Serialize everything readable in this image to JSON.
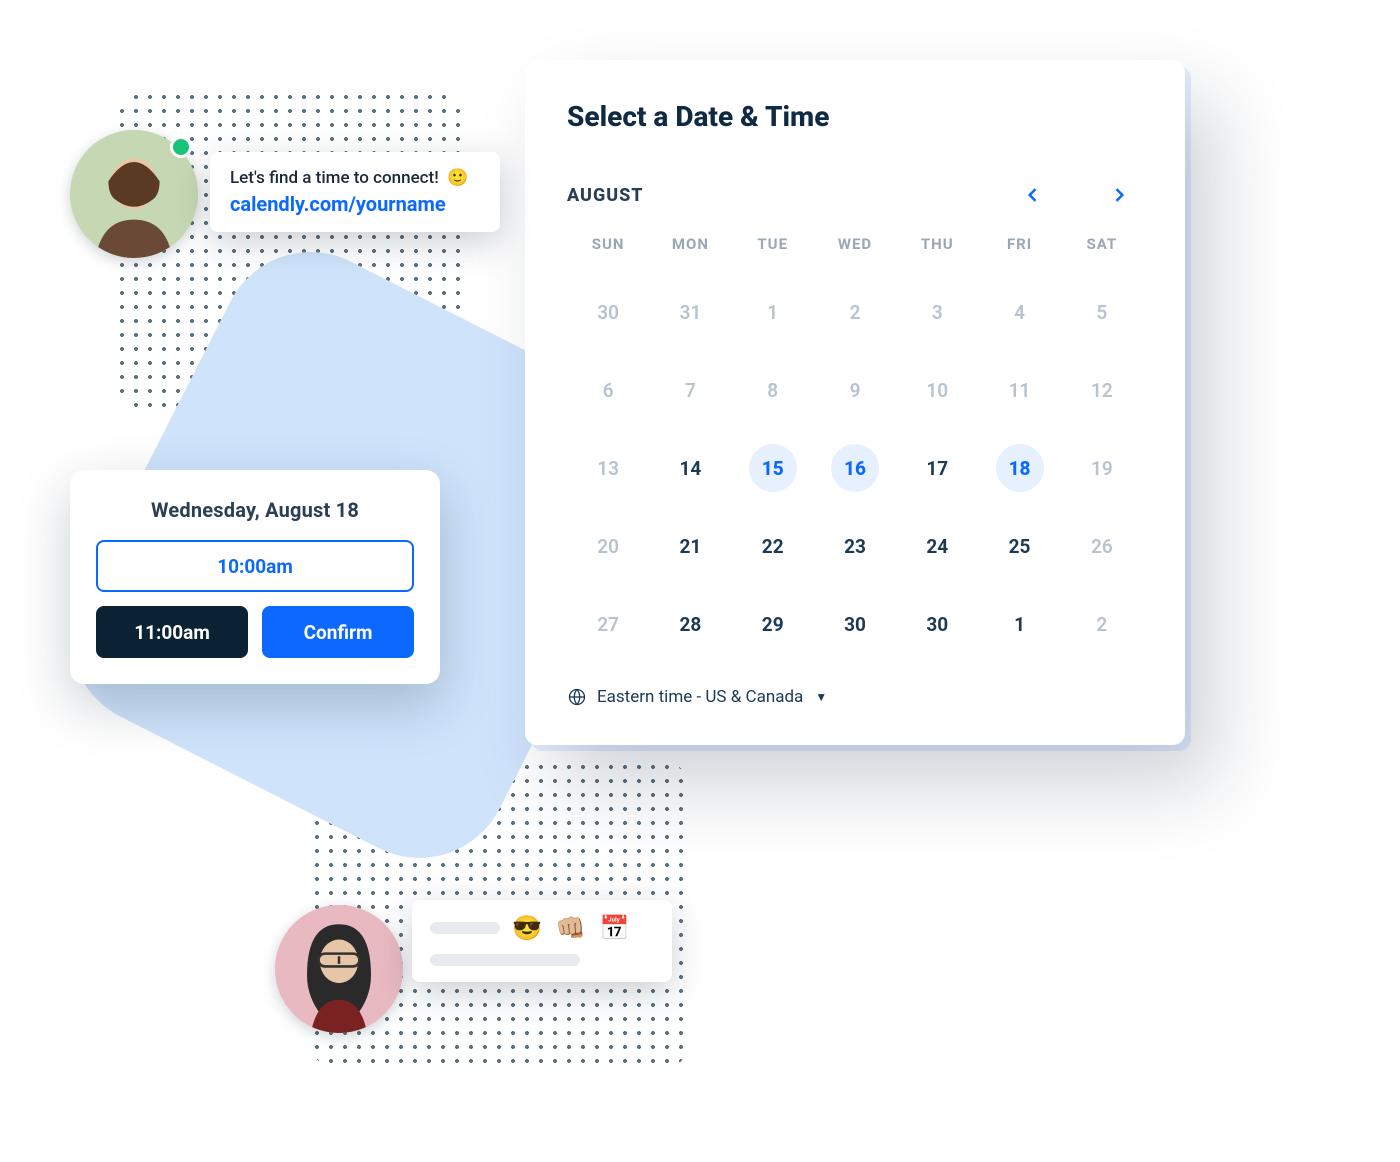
{
  "colors": {
    "primary": "#0b69ff",
    "dark": "#0a2233",
    "text": "#1d3a54"
  },
  "avatar_top": {
    "presence": "online"
  },
  "message_top": {
    "text": "Let's find a time to connect!",
    "emoji": "🙂",
    "link": "calendly.com/yourname"
  },
  "message_bottom": {
    "emojis": "😎 👊🏼 📅"
  },
  "time_card": {
    "date_label": "Wednesday, August 18",
    "slot_outline": "10:00am",
    "slot_selected": "11:00am",
    "confirm_label": "Confirm"
  },
  "calendar": {
    "title": "Select a Date & Time",
    "month_label": "AUGUST",
    "day_headers": [
      "SUN",
      "MON",
      "TUE",
      "WED",
      "THU",
      "FRI",
      "SAT"
    ],
    "weeks": [
      [
        {
          "n": "30",
          "state": "muted"
        },
        {
          "n": "31",
          "state": "muted"
        },
        {
          "n": "1",
          "state": "muted"
        },
        {
          "n": "2",
          "state": "muted"
        },
        {
          "n": "3",
          "state": "muted"
        },
        {
          "n": "4",
          "state": "muted"
        },
        {
          "n": "5",
          "state": "muted"
        }
      ],
      [
        {
          "n": "6",
          "state": "muted"
        },
        {
          "n": "7",
          "state": "muted"
        },
        {
          "n": "8",
          "state": "muted"
        },
        {
          "n": "9",
          "state": "muted"
        },
        {
          "n": "10",
          "state": "muted"
        },
        {
          "n": "11",
          "state": "muted"
        },
        {
          "n": "12",
          "state": "muted"
        }
      ],
      [
        {
          "n": "13",
          "state": "muted"
        },
        {
          "n": "14",
          "state": "in"
        },
        {
          "n": "15",
          "state": "avail"
        },
        {
          "n": "16",
          "state": "avail"
        },
        {
          "n": "17",
          "state": "in"
        },
        {
          "n": "18",
          "state": "avail"
        },
        {
          "n": "19",
          "state": "muted"
        }
      ],
      [
        {
          "n": "20",
          "state": "muted"
        },
        {
          "n": "21",
          "state": "in"
        },
        {
          "n": "22",
          "state": "in"
        },
        {
          "n": "23",
          "state": "in"
        },
        {
          "n": "24",
          "state": "in"
        },
        {
          "n": "25",
          "state": "in"
        },
        {
          "n": "26",
          "state": "muted"
        }
      ],
      [
        {
          "n": "27",
          "state": "muted"
        },
        {
          "n": "28",
          "state": "in"
        },
        {
          "n": "29",
          "state": "in"
        },
        {
          "n": "30",
          "state": "in"
        },
        {
          "n": "30",
          "state": "in"
        },
        {
          "n": "1",
          "state": "in"
        },
        {
          "n": "2",
          "state": "muted"
        }
      ]
    ],
    "timezone_label": "Eastern time - US & Canada"
  }
}
